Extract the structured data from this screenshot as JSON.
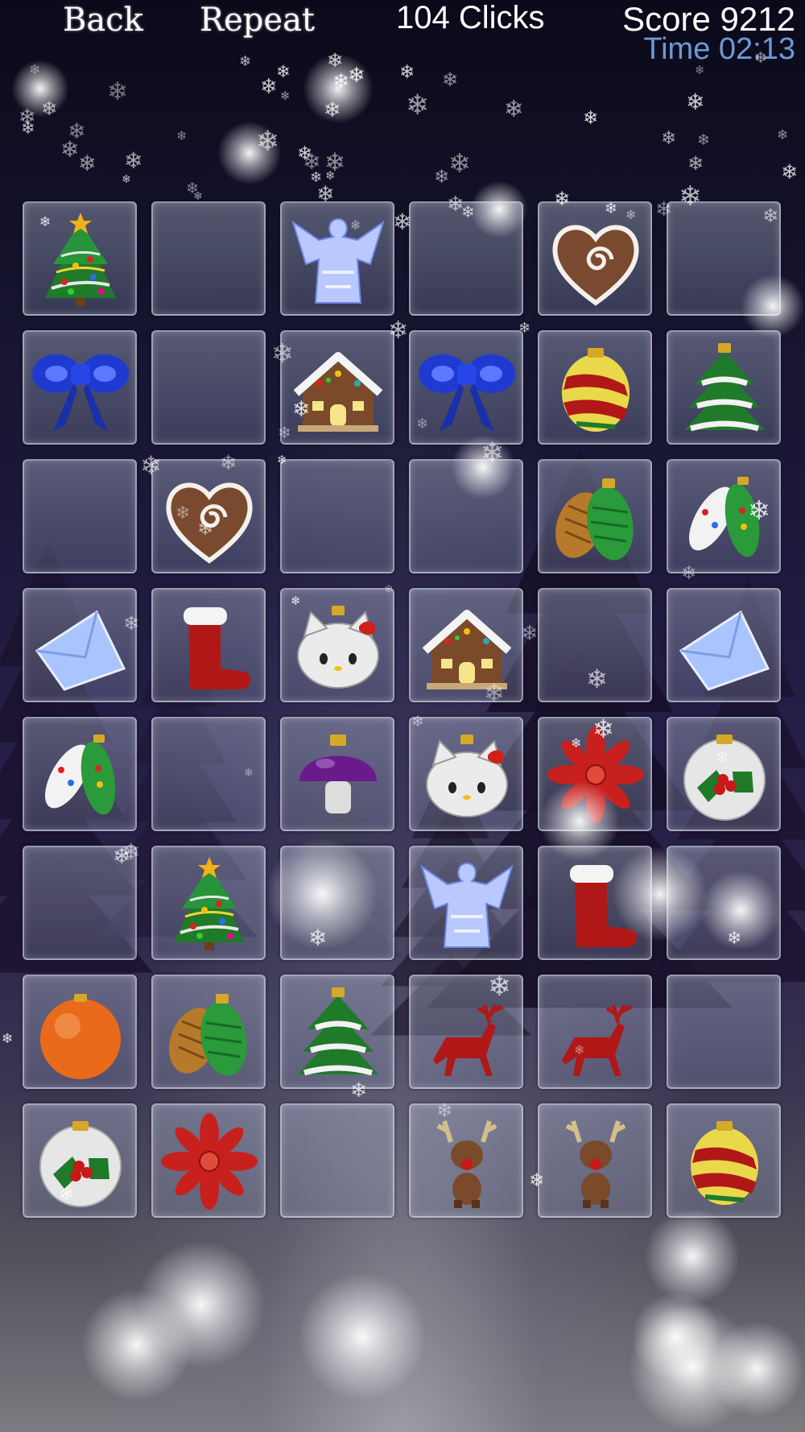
{
  "topbar": {
    "back_label": "Back",
    "repeat_label": "Repeat",
    "clicks_label": "104 Clicks",
    "score_label": "Score 9212",
    "time_label": "Time 02:13"
  },
  "board": {
    "rows": [
      [
        "christmas-tree",
        "empty",
        "angel",
        "empty",
        "gingerbread-heart",
        "empty"
      ],
      [
        "blue-bow",
        "empty",
        "gingerbread-house",
        "blue-bow",
        "striped-ornament",
        "snowy-tree"
      ],
      [
        "empty",
        "gingerbread-heart",
        "empty",
        "empty",
        "pine-cones",
        "painted-ornaments"
      ],
      [
        "envelope",
        "santa-boot",
        "kitty-ornament",
        "gingerbread-house",
        "empty",
        "envelope"
      ],
      [
        "painted-ornaments",
        "empty",
        "purple-mushroom",
        "kitty-ornament",
        "poinsettia",
        "holly-ornament"
      ],
      [
        "empty",
        "christmas-tree",
        "empty",
        "angel",
        "santa-boot",
        "empty"
      ],
      [
        "orange-bauble",
        "pine-cones",
        "snowy-tree",
        "reindeer-silhouette",
        "reindeer-silhouette",
        "empty"
      ],
      [
        "holly-ornament",
        "poinsettia",
        "empty",
        "reindeer-toy",
        "reindeer-toy",
        "striped-ornament"
      ]
    ]
  },
  "colors": {
    "time_text": "#6c9ad6",
    "bow_blue": "#1f3ad0",
    "boot_red": "#b01818",
    "poinsettia_red": "#c8211d",
    "tree_green": "#1f7a2a",
    "purple": "#6a1a8a",
    "orange": "#e86a1a"
  }
}
